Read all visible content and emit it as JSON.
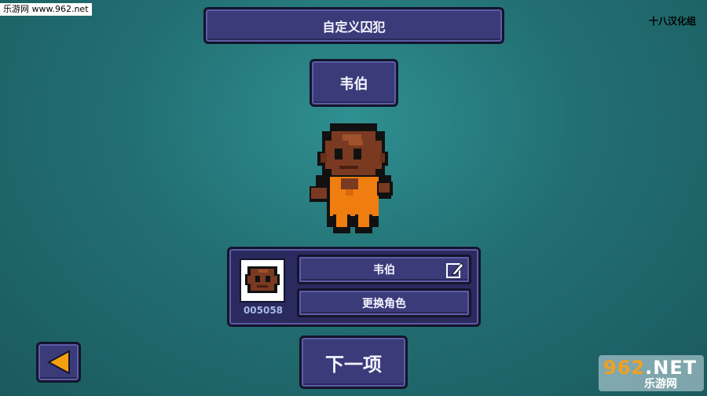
{
  "watermark_top_left": "乐游网 www.962.net",
  "credit": "十八汉化组",
  "title": "自定义囚犯",
  "character_name": "韦伯",
  "info": {
    "id": "005058",
    "name_field": "韦伯",
    "change_character": "更换角色"
  },
  "next_button": "下一项",
  "watermark_bottom_right": {
    "brand_a": "962",
    "brand_b": ".NET",
    "site": "乐游网"
  },
  "colors": {
    "background": "#226f72",
    "panel": "#3b3b7a",
    "skin": "#7a3a22",
    "uniform": "#f07d10",
    "back_arrow": "#f5a10f"
  },
  "icons": [
    "edit-icon",
    "back-arrow-icon"
  ]
}
